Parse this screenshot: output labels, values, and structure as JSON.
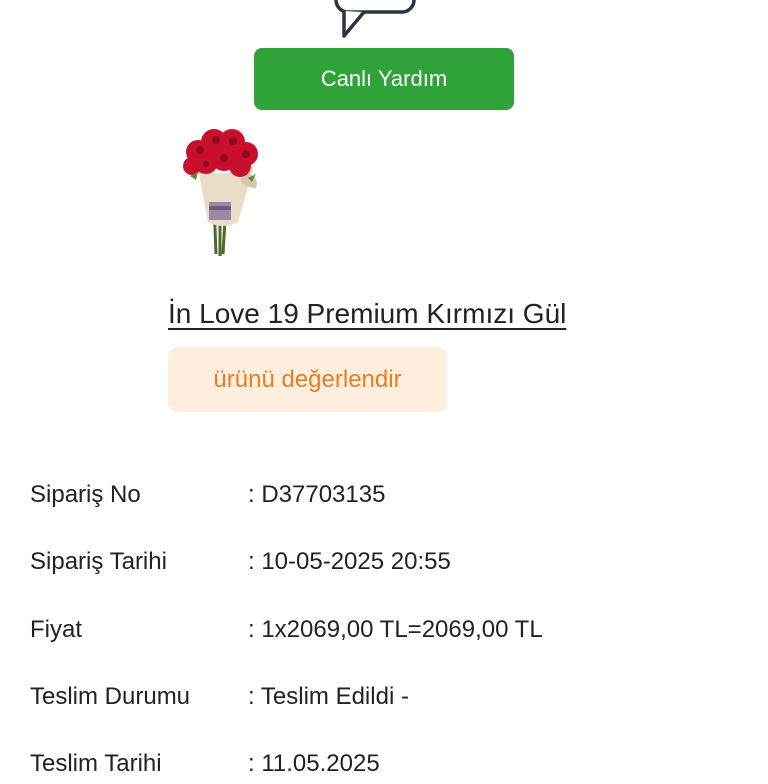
{
  "help": {
    "button_label": "Canlı Yardım"
  },
  "product": {
    "title": "İn Love 19 Premium Kırmızı Gül",
    "rate_label": "ürünü değerlendir"
  },
  "colors": {
    "help_button": "#2fa23a",
    "rate_bg": "#fdeedd",
    "rate_text": "#e67e22"
  },
  "order_details": [
    {
      "label": "Sipariş No",
      "value": ": D37703135"
    },
    {
      "label": "Sipariş Tarihi",
      "value": ": 10-05-2025 20:55"
    },
    {
      "label": "Fiyat",
      "value": ": 1x2069,00 TL=2069,00 TL"
    },
    {
      "label": "Teslim Durumu",
      "value": ": Teslim Edildi -"
    },
    {
      "label": "Teslim Tarihi",
      "value": ": 11.05.2025"
    }
  ]
}
